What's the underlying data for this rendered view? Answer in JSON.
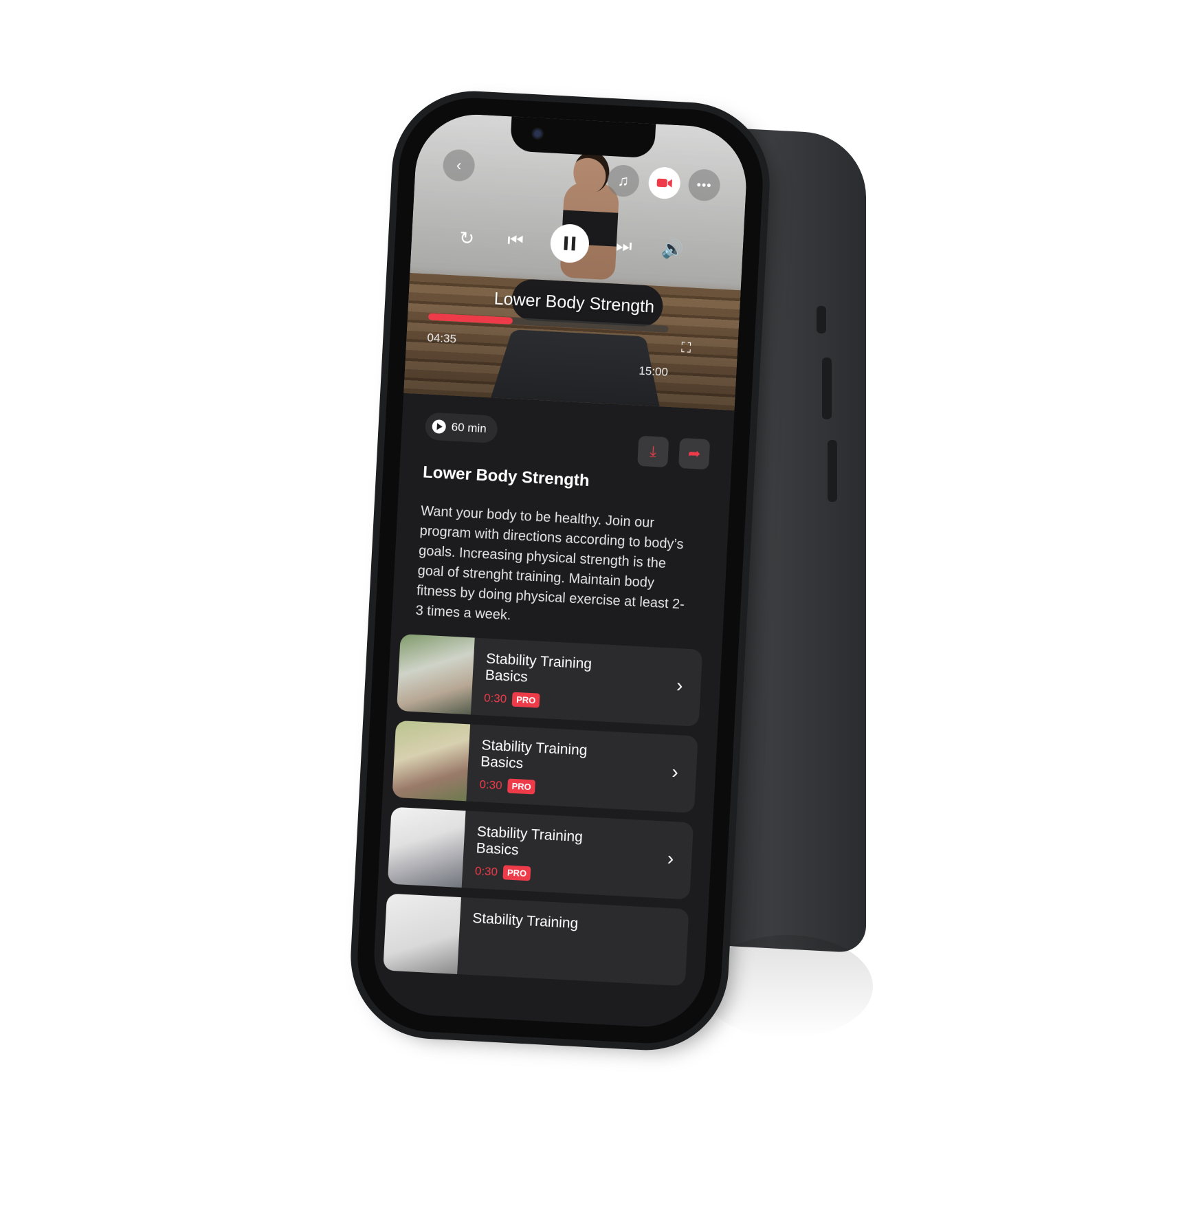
{
  "player": {
    "title": "Lower Body Strength",
    "current_time": "04:35",
    "total_time": "15:00",
    "progress_fraction": 0.35,
    "top_icons": [
      "back-icon",
      "music-icon",
      "record-icon",
      "more-icon"
    ],
    "controls": [
      "repeat-icon",
      "previous-icon",
      "pause-icon",
      "next-icon",
      "volume-icon",
      "fullscreen-icon"
    ]
  },
  "details": {
    "duration": "60 min",
    "title": "Lower Body Strength",
    "description": "Want your body to be healthy. Join our program with directions according to body’s goals. Increasing physical strength is the goal of strenght training. Maintain body fitness by doing physical exercise at least 2-3 times a week.",
    "actions": [
      "download-icon",
      "share-icon"
    ]
  },
  "workouts": [
    {
      "title": "Stability Training Basics",
      "time": "0:30",
      "badge": "PRO"
    },
    {
      "title": "Stability Training Basics",
      "time": "0:30",
      "badge": "PRO"
    },
    {
      "title": "Stability Training Basics",
      "time": "0:30",
      "badge": "PRO"
    },
    {
      "title": "Stability Training",
      "time": "",
      "badge": ""
    }
  ],
  "colors": {
    "accent": "#ee3b49",
    "background": "#1c1c1e",
    "card": "#2b2b2e"
  }
}
